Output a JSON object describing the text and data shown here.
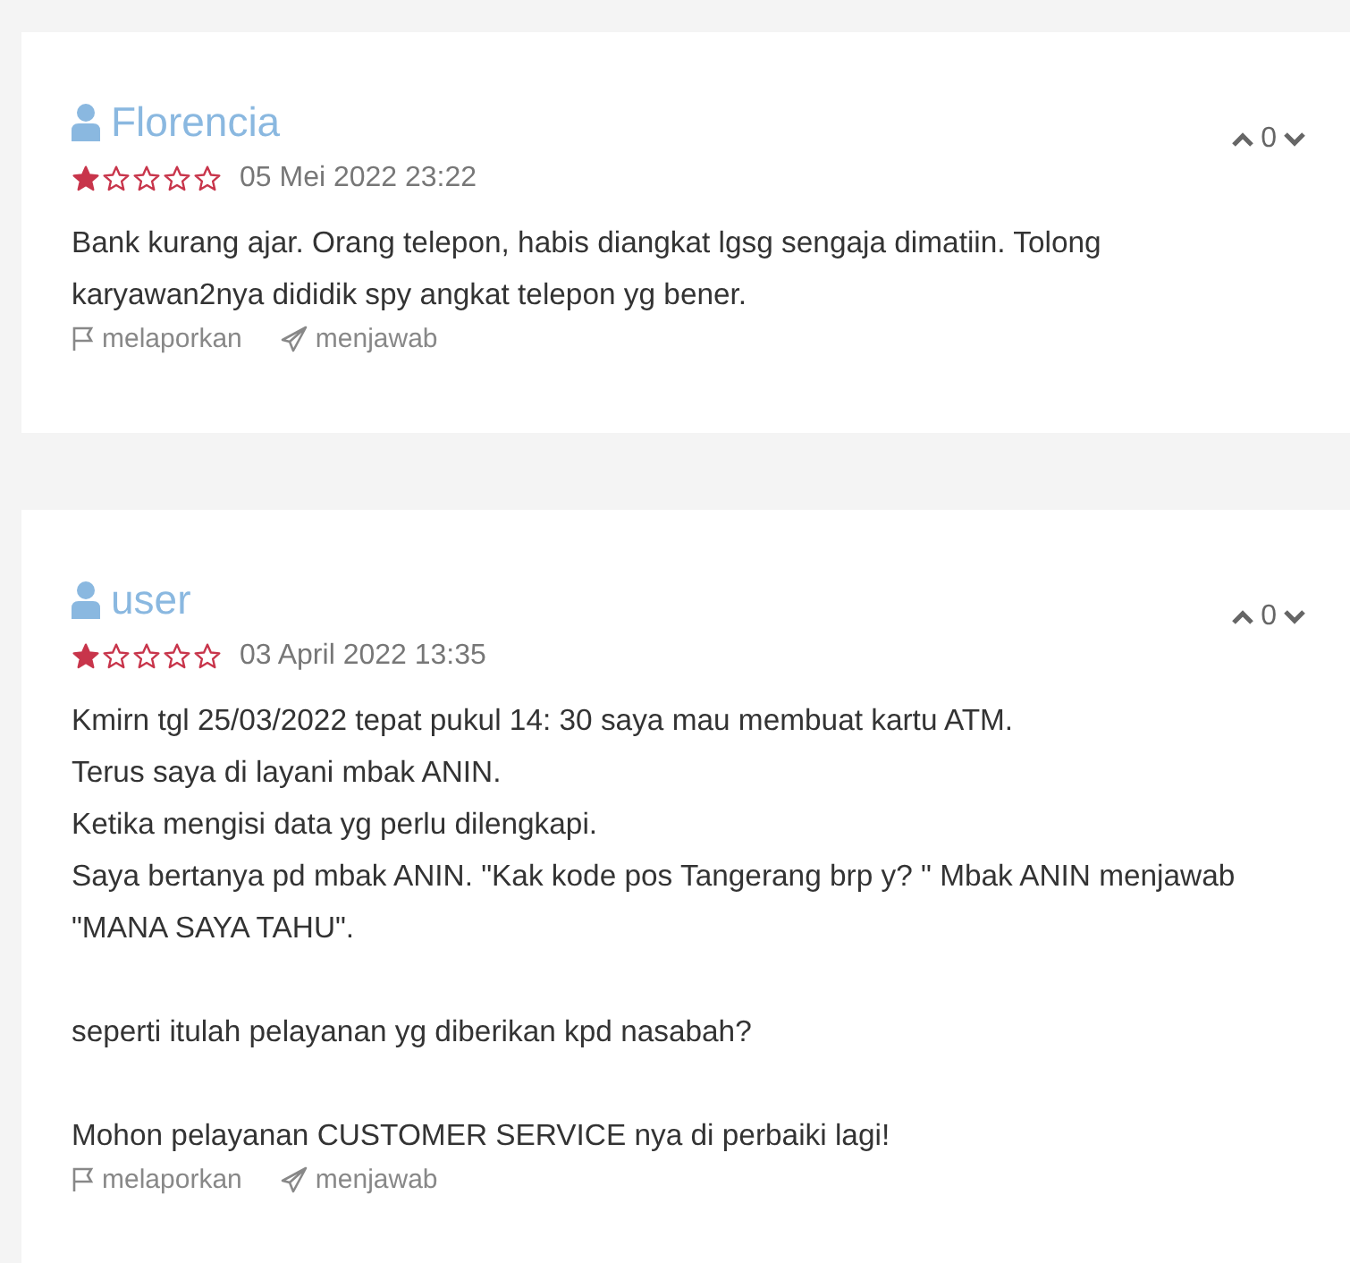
{
  "reviews": [
    {
      "author": "Florencia",
      "stars": 1,
      "date": "05 Mei 2022 23:22",
      "votes": "0",
      "paragraphs": [
        "Bank kurang ajar. Orang telepon, habis diangkat lgsg sengaja dimatiin. Tolong karyawan2nya dididik spy angkat telepon yg bener."
      ],
      "actions": [
        "melaporkan",
        "menjawab"
      ]
    },
    {
      "author": "user",
      "stars": 1,
      "date": "03 April 2022 13:35",
      "votes": "0",
      "paragraphs": [
        "Kmirn tgl 25/03/2022 tepat pukul 14: 30 saya mau membuat kartu ATM.\nTerus saya di layani mbak ANIN.\nKetika mengisi data yg perlu dilengkapi.\nSaya bertanya pd mbak ANIN. \"Kak kode pos Tangerang brp y? \" Mbak ANIN menjawab\n\"MANA SAYA TAHU\".",
        "seperti itulah pelayanan yg diberikan kpd nasabah?",
        "Mohon pelayanan CUSTOMER SERVICE nya di perbaiki lagi!"
      ],
      "actions": [
        "melaporkan",
        "menjawab"
      ]
    }
  ]
}
